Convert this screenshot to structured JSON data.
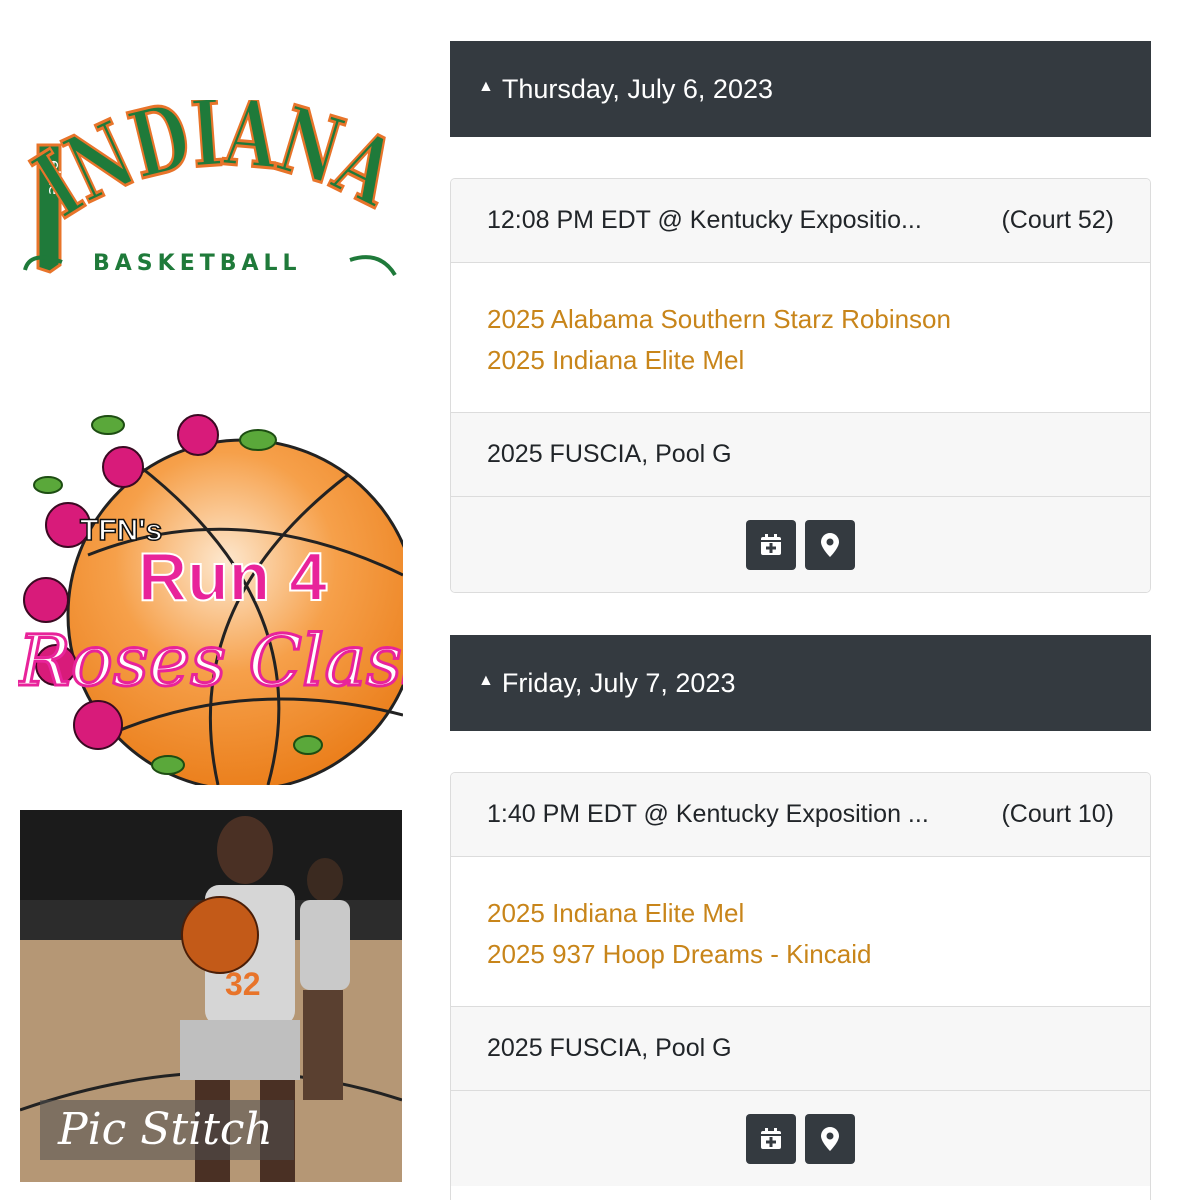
{
  "logos": {
    "indiana": {
      "top_text": "INDIANA",
      "vertical_text": "elite",
      "bottom_text": "BASKETBALL"
    },
    "run4": {
      "tfn": "TFN's",
      "run": "Run 4",
      "roses": "Roses Classic"
    }
  },
  "photo": {
    "jersey_number": "32",
    "watermark": "Pic Stitch"
  },
  "days": [
    {
      "date_label": "Thursday, July 6, 2023",
      "game": {
        "time_location": "12:08 PM EDT @  Kentucky Expositio...",
        "court": "(Court 52)",
        "teams": [
          "2025 Alabama Southern Starz Robinson",
          "2025 Indiana Elite Mel"
        ],
        "pool": "2025 FUSCIA, Pool G"
      }
    },
    {
      "date_label": "Friday, July 7, 2023",
      "game": {
        "time_location": "1:40 PM EDT @  Kentucky Exposition ...",
        "court": "(Court 10)",
        "teams": [
          "2025 Indiana Elite Mel",
          "2025 937 Hoop Dreams - Kincaid"
        ],
        "pool": "2025 FUSCIA, Pool G"
      }
    }
  ],
  "colors": {
    "header_bg": "#343a40",
    "team_link": "#c8851a",
    "indiana_green": "#1f7a3a",
    "indiana_orange": "#e8742a",
    "run4_pink": "#e8239a"
  }
}
